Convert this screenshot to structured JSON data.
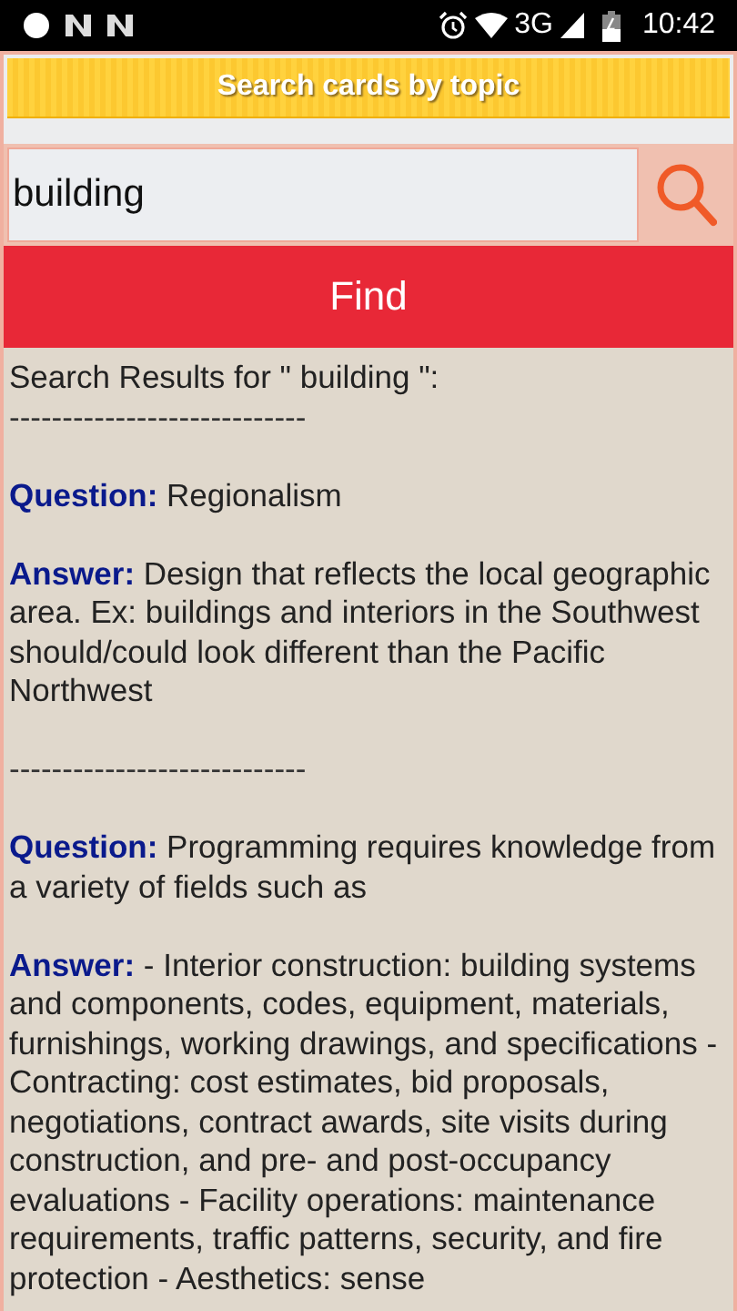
{
  "status_bar": {
    "network": "3G",
    "time": "10:42"
  },
  "header": {
    "title": "Search cards by topic"
  },
  "search": {
    "value": "building"
  },
  "find_button": {
    "label": "Find"
  },
  "results": {
    "heading": "Search Results for \" building \":",
    "entries": [
      {
        "kind": "separator",
        "text": "----------------------------"
      },
      {
        "kind": "qa",
        "question": "**Question:** Regionalism",
        "answer": "**Answer:** Design that reflects the local geographic area. Ex: buildings and interiors in the Southwest should/could look different than the Pacific Northwest"
      },
      {
        "kind": "separator",
        "text": "----------------------------"
      },
      {
        "kind": "qa",
        "question": "**Question:** Programming requires knowledge from a variety of fields such as",
        "answer": "**Answer:** - Interior construction: building systems and components, codes, equipment, materials, furnishings, working drawings, and specifications - Contracting: cost estimates, bid proposals, negotiations, contract awards, site visits during construction, and pre- and post-occupancy evaluations - Facility operations: maintenance requirements, traffic patterns, security, and fire protection - Aesthetics: sense"
      }
    ]
  }
}
